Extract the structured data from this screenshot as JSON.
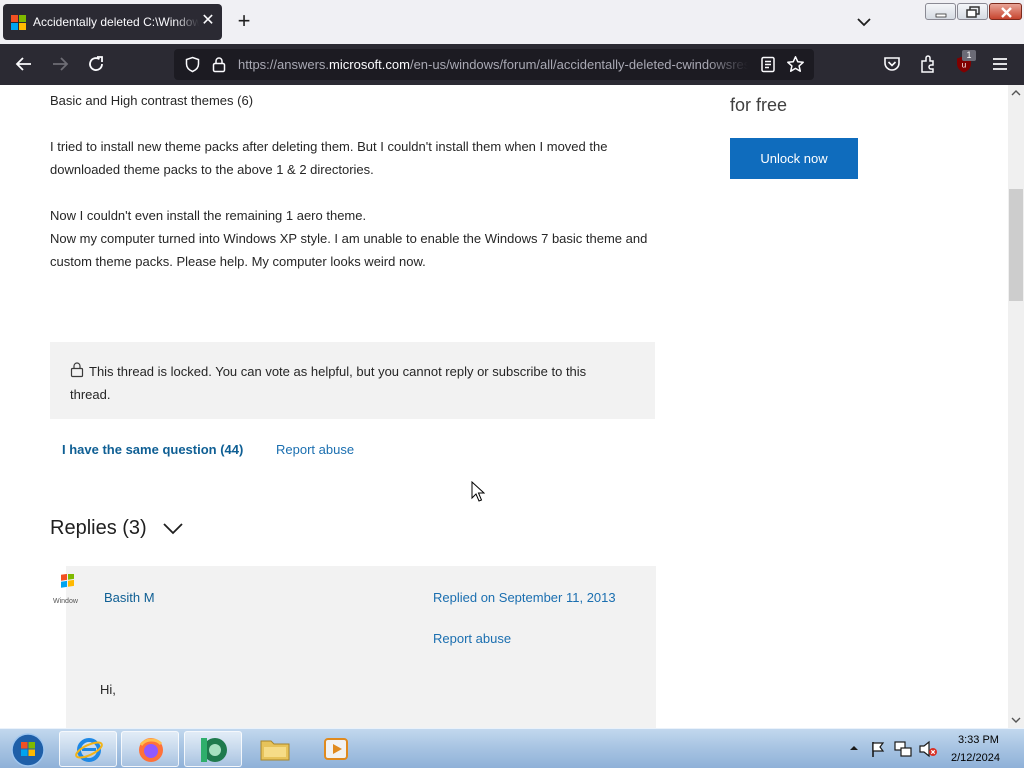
{
  "browser": {
    "tab_title": "Accidentally deleted C:\\Windows\\resources\\themes",
    "url_prefix": "https://answers.",
    "url_domain": "microsoft.com",
    "url_path": "/en-us/windows/forum/all/accidentally-deleted-cwindowsresources/",
    "extension_badge": "1",
    "icons": [
      "back-icon",
      "forward-icon",
      "reload-icon",
      "shield-icon",
      "lock-icon",
      "reader-view-icon",
      "bookmark-star-icon",
      "pocket-icon",
      "extensions-icon",
      "ublock-icon",
      "menu-icon"
    ]
  },
  "article": {
    "line_themes": "Basic and High contrast themes (6)",
    "para_install": "I tried to install new theme packs after deleting them. But I couldn't install them when I moved the downloaded theme packs to the above 1 & 2 directories.",
    "line_aero": "Now I couldn't even install the remaining 1 aero theme.",
    "para_xp": "Now my computer turned into Windows XP style. I am unable to enable the Windows 7 basic theme and custom theme packs. Please help. My computer looks weird now.",
    "locked_notice": "This thread is locked. You can vote as helpful, but you cannot reply or subscribe to this thread.",
    "same_question": "I have the same question (44)",
    "report_abuse": "Report abuse"
  },
  "replies": {
    "heading": "Replies (3)",
    "first": {
      "author": "Basith M",
      "date": "Replied on September 11, 2013",
      "report": "Report abuse",
      "greeting": "Hi,"
    }
  },
  "sidebar": {
    "for_free": "for free",
    "unlock_button": "Unlock now"
  },
  "taskbar": {
    "time": "3:33 PM",
    "date": "2/12/2024",
    "pinned": [
      "internet-explorer",
      "firefox",
      "app-green",
      "file-explorer",
      "media-player"
    ]
  },
  "colors": {
    "link": "#1b6fb0",
    "accent_button": "#0f6cbd",
    "browser_dark": "#2b2a33"
  }
}
